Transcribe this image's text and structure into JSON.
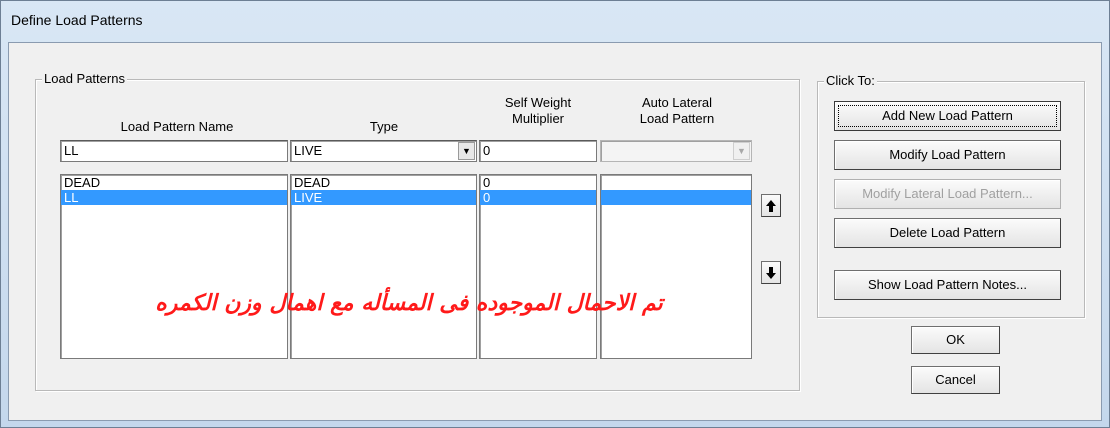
{
  "window": {
    "title": "Define Load Patterns"
  },
  "load_patterns": {
    "group_label": "Load Patterns",
    "headers": {
      "name": "Load Pattern Name",
      "type": "Type",
      "self_weight_line1": "Self Weight",
      "self_weight_line2": "Multiplier",
      "auto_lateral_line1": "Auto Lateral",
      "auto_lateral_line2": "Load Pattern"
    },
    "edit": {
      "name": "LL",
      "type": "LIVE",
      "self_weight": "0",
      "auto_lateral": ""
    },
    "rows": [
      {
        "name": "DEAD",
        "type": "DEAD",
        "self_weight": "0",
        "auto_lateral": "",
        "selected": false
      },
      {
        "name": "LL",
        "type": "LIVE",
        "self_weight": "0",
        "auto_lateral": "",
        "selected": true
      }
    ]
  },
  "click_to": {
    "group_label": "Click To:",
    "buttons": {
      "add": "Add New Load Pattern",
      "modify": "Modify Load Pattern",
      "modify_lateral": "Modify Lateral Load Pattern...",
      "delete": "Delete Load Pattern",
      "show_notes": "Show Load Pattern Notes..."
    }
  },
  "dialog_buttons": {
    "ok": "OK",
    "cancel": "Cancel"
  },
  "annotation": {
    "text": "تم الاحمال الموجوده فى المسأله مع اهمال وزن الكمره",
    "color": "#ff1a1a"
  },
  "icons": {
    "move_up": "arrow-up-icon",
    "move_down": "arrow-down-icon",
    "dropdown": "chevron-down-icon"
  },
  "colors": {
    "selection": "#3399ff",
    "title_bar": "#c4d7ec"
  }
}
